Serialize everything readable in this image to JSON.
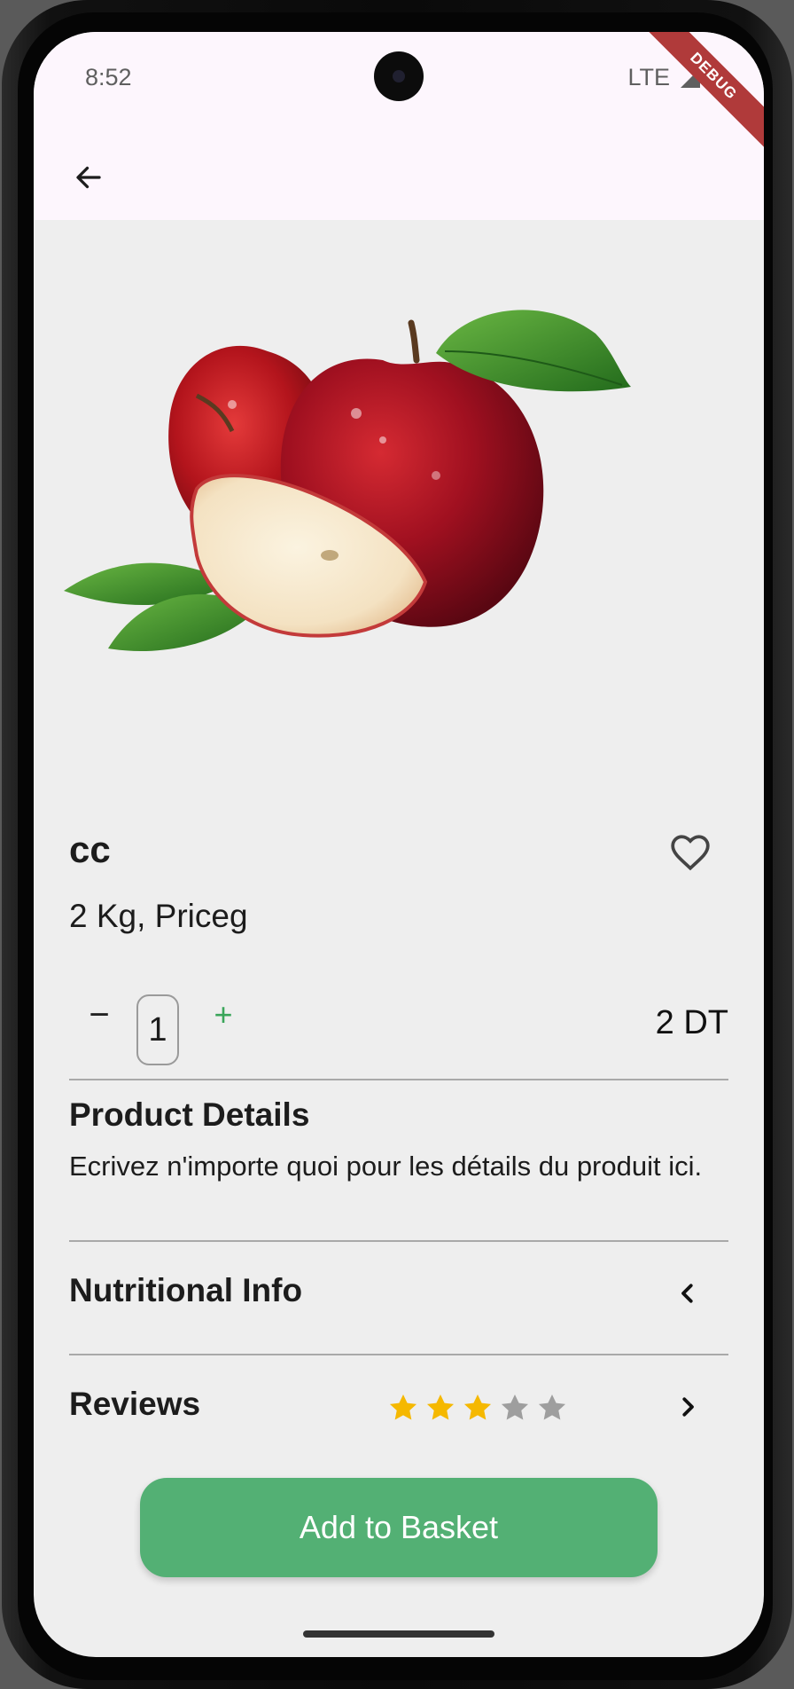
{
  "status_bar": {
    "time": "8:52",
    "network": "LTE",
    "debug_banner": "DEBUG"
  },
  "product": {
    "name": "cc",
    "subtitle": "2 Kg, Priceg",
    "quantity": "1",
    "price": "2 DT"
  },
  "quantity_controls": {
    "minus": "−",
    "plus": "+"
  },
  "details": {
    "title": "Product Details",
    "text": "Ecrivez n'importe quoi pour les détails du produit ici."
  },
  "nutrition": {
    "title": "Nutritional Info"
  },
  "reviews": {
    "title": "Reviews",
    "rating": 3,
    "max": 5
  },
  "actions": {
    "add_to_basket": "Add to Basket"
  },
  "colors": {
    "accent_green": "#53b074",
    "star_filled": "#f5b800",
    "star_empty": "#9e9e9e",
    "app_bar": "#fdf6fd",
    "background": "#eeeeee"
  }
}
